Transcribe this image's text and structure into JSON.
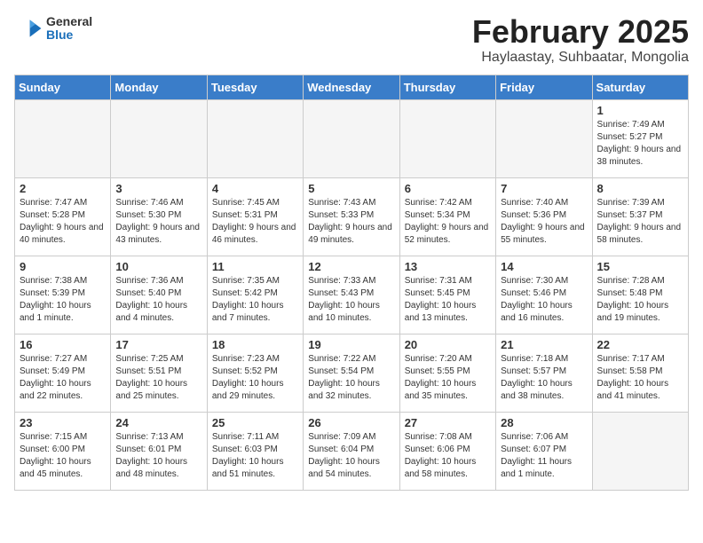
{
  "header": {
    "logo": {
      "general": "General",
      "blue": "Blue"
    },
    "title": "February 2025",
    "subtitle": "Haylaastay, Suhbaatar, Mongolia"
  },
  "weekdays": [
    "Sunday",
    "Monday",
    "Tuesday",
    "Wednesday",
    "Thursday",
    "Friday",
    "Saturday"
  ],
  "weeks": [
    [
      {
        "day": "",
        "info": ""
      },
      {
        "day": "",
        "info": ""
      },
      {
        "day": "",
        "info": ""
      },
      {
        "day": "",
        "info": ""
      },
      {
        "day": "",
        "info": ""
      },
      {
        "day": "",
        "info": ""
      },
      {
        "day": "1",
        "info": "Sunrise: 7:49 AM\nSunset: 5:27 PM\nDaylight: 9 hours and 38 minutes."
      }
    ],
    [
      {
        "day": "2",
        "info": "Sunrise: 7:47 AM\nSunset: 5:28 PM\nDaylight: 9 hours and 40 minutes."
      },
      {
        "day": "3",
        "info": "Sunrise: 7:46 AM\nSunset: 5:30 PM\nDaylight: 9 hours and 43 minutes."
      },
      {
        "day": "4",
        "info": "Sunrise: 7:45 AM\nSunset: 5:31 PM\nDaylight: 9 hours and 46 minutes."
      },
      {
        "day": "5",
        "info": "Sunrise: 7:43 AM\nSunset: 5:33 PM\nDaylight: 9 hours and 49 minutes."
      },
      {
        "day": "6",
        "info": "Sunrise: 7:42 AM\nSunset: 5:34 PM\nDaylight: 9 hours and 52 minutes."
      },
      {
        "day": "7",
        "info": "Sunrise: 7:40 AM\nSunset: 5:36 PM\nDaylight: 9 hours and 55 minutes."
      },
      {
        "day": "8",
        "info": "Sunrise: 7:39 AM\nSunset: 5:37 PM\nDaylight: 9 hours and 58 minutes."
      }
    ],
    [
      {
        "day": "9",
        "info": "Sunrise: 7:38 AM\nSunset: 5:39 PM\nDaylight: 10 hours and 1 minute."
      },
      {
        "day": "10",
        "info": "Sunrise: 7:36 AM\nSunset: 5:40 PM\nDaylight: 10 hours and 4 minutes."
      },
      {
        "day": "11",
        "info": "Sunrise: 7:35 AM\nSunset: 5:42 PM\nDaylight: 10 hours and 7 minutes."
      },
      {
        "day": "12",
        "info": "Sunrise: 7:33 AM\nSunset: 5:43 PM\nDaylight: 10 hours and 10 minutes."
      },
      {
        "day": "13",
        "info": "Sunrise: 7:31 AM\nSunset: 5:45 PM\nDaylight: 10 hours and 13 minutes."
      },
      {
        "day": "14",
        "info": "Sunrise: 7:30 AM\nSunset: 5:46 PM\nDaylight: 10 hours and 16 minutes."
      },
      {
        "day": "15",
        "info": "Sunrise: 7:28 AM\nSunset: 5:48 PM\nDaylight: 10 hours and 19 minutes."
      }
    ],
    [
      {
        "day": "16",
        "info": "Sunrise: 7:27 AM\nSunset: 5:49 PM\nDaylight: 10 hours and 22 minutes."
      },
      {
        "day": "17",
        "info": "Sunrise: 7:25 AM\nSunset: 5:51 PM\nDaylight: 10 hours and 25 minutes."
      },
      {
        "day": "18",
        "info": "Sunrise: 7:23 AM\nSunset: 5:52 PM\nDaylight: 10 hours and 29 minutes."
      },
      {
        "day": "19",
        "info": "Sunrise: 7:22 AM\nSunset: 5:54 PM\nDaylight: 10 hours and 32 minutes."
      },
      {
        "day": "20",
        "info": "Sunrise: 7:20 AM\nSunset: 5:55 PM\nDaylight: 10 hours and 35 minutes."
      },
      {
        "day": "21",
        "info": "Sunrise: 7:18 AM\nSunset: 5:57 PM\nDaylight: 10 hours and 38 minutes."
      },
      {
        "day": "22",
        "info": "Sunrise: 7:17 AM\nSunset: 5:58 PM\nDaylight: 10 hours and 41 minutes."
      }
    ],
    [
      {
        "day": "23",
        "info": "Sunrise: 7:15 AM\nSunset: 6:00 PM\nDaylight: 10 hours and 45 minutes."
      },
      {
        "day": "24",
        "info": "Sunrise: 7:13 AM\nSunset: 6:01 PM\nDaylight: 10 hours and 48 minutes."
      },
      {
        "day": "25",
        "info": "Sunrise: 7:11 AM\nSunset: 6:03 PM\nDaylight: 10 hours and 51 minutes."
      },
      {
        "day": "26",
        "info": "Sunrise: 7:09 AM\nSunset: 6:04 PM\nDaylight: 10 hours and 54 minutes."
      },
      {
        "day": "27",
        "info": "Sunrise: 7:08 AM\nSunset: 6:06 PM\nDaylight: 10 hours and 58 minutes."
      },
      {
        "day": "28",
        "info": "Sunrise: 7:06 AM\nSunset: 6:07 PM\nDaylight: 11 hours and 1 minute."
      },
      {
        "day": "",
        "info": ""
      }
    ]
  ]
}
